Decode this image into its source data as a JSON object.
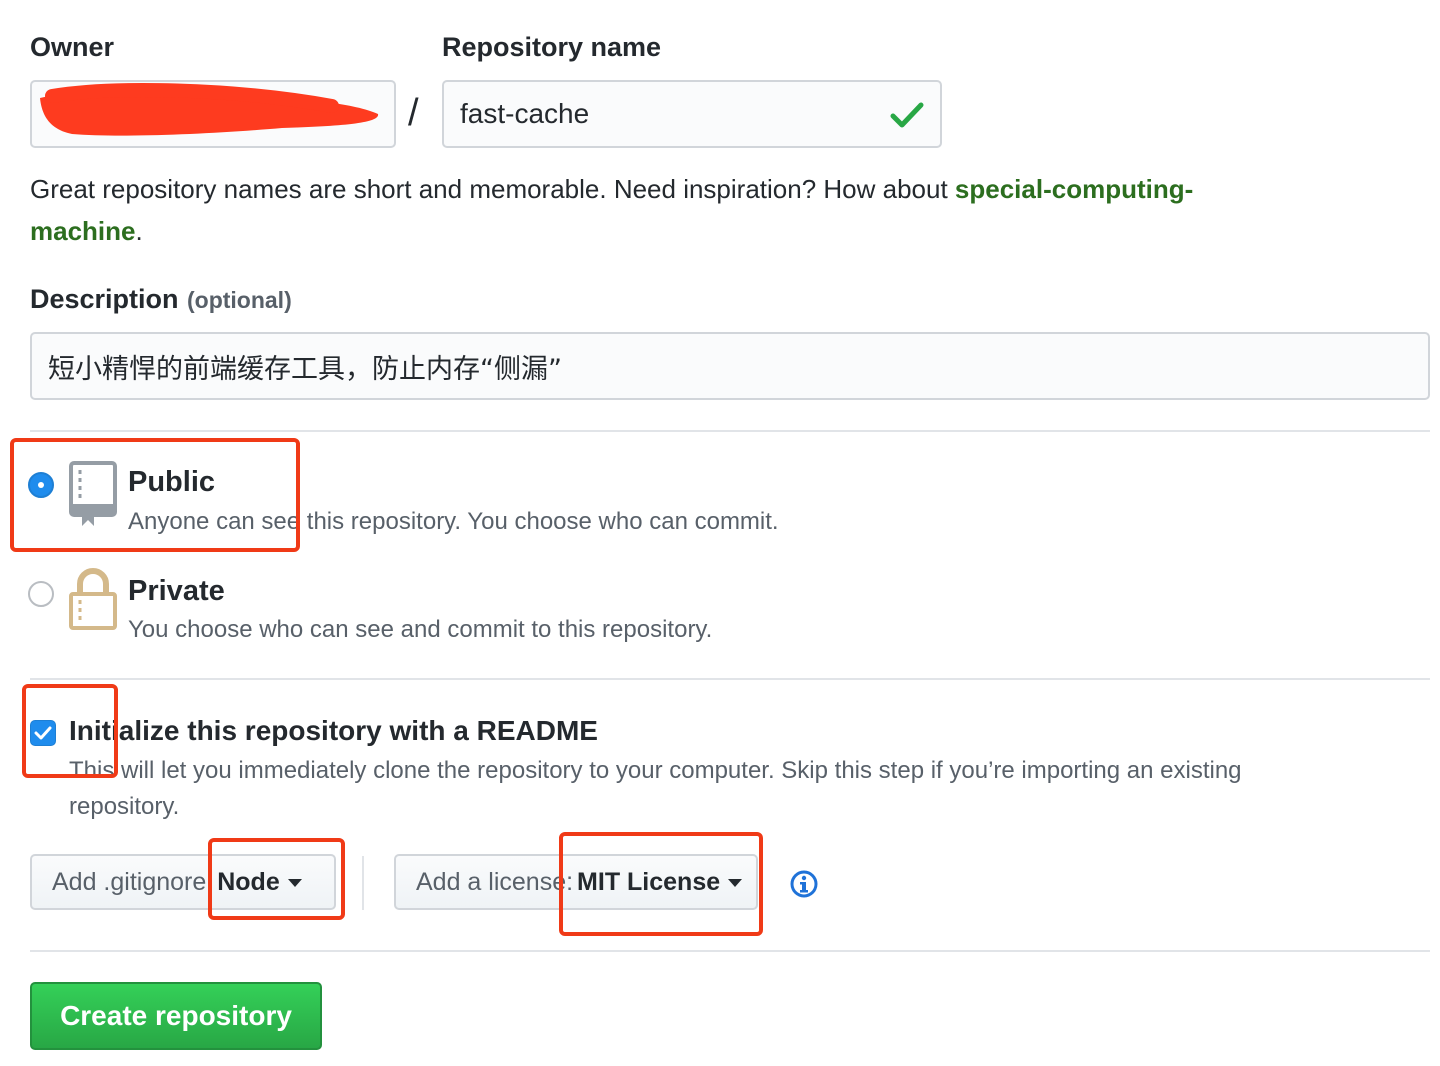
{
  "owner": {
    "label": "Owner"
  },
  "repo": {
    "label": "Repository name",
    "value": "fast-cache",
    "separator": "/"
  },
  "suggestion": {
    "text": "Great repository names are short and memorable. Need inspiration? How about ",
    "link_line1": "special-computing-",
    "link_line2": "machine",
    "end": "."
  },
  "description": {
    "label": "Description",
    "optional": "(optional)",
    "value": "短小精悍的前端缓存工具，防止内存“侧漏”"
  },
  "visibility": {
    "public": {
      "title": "Public",
      "desc": "Anyone can see this repository. You choose who can commit.",
      "checked": true
    },
    "private": {
      "title": "Private",
      "desc": "You choose who can see and commit to this repository.",
      "checked": false
    }
  },
  "readme": {
    "title": "Initialize this repository with a README",
    "desc_line1": "This will let you immediately clone the repository to your computer. Skip this step if you’re importing an existing",
    "desc_line2": "repository.",
    "checked": true
  },
  "gitignore": {
    "prefix": "Add .gitignore:",
    "value": "Node"
  },
  "license": {
    "prefix": "Add a license:",
    "value": "MIT License"
  },
  "create_button": "Create repository",
  "colors": {
    "accent_green": "#28a745",
    "link_green": "#2c6e1f",
    "checkbox_blue": "#1f8ced",
    "annotation_red": "#f03a17",
    "scribble_red": "#fe3b1f"
  }
}
